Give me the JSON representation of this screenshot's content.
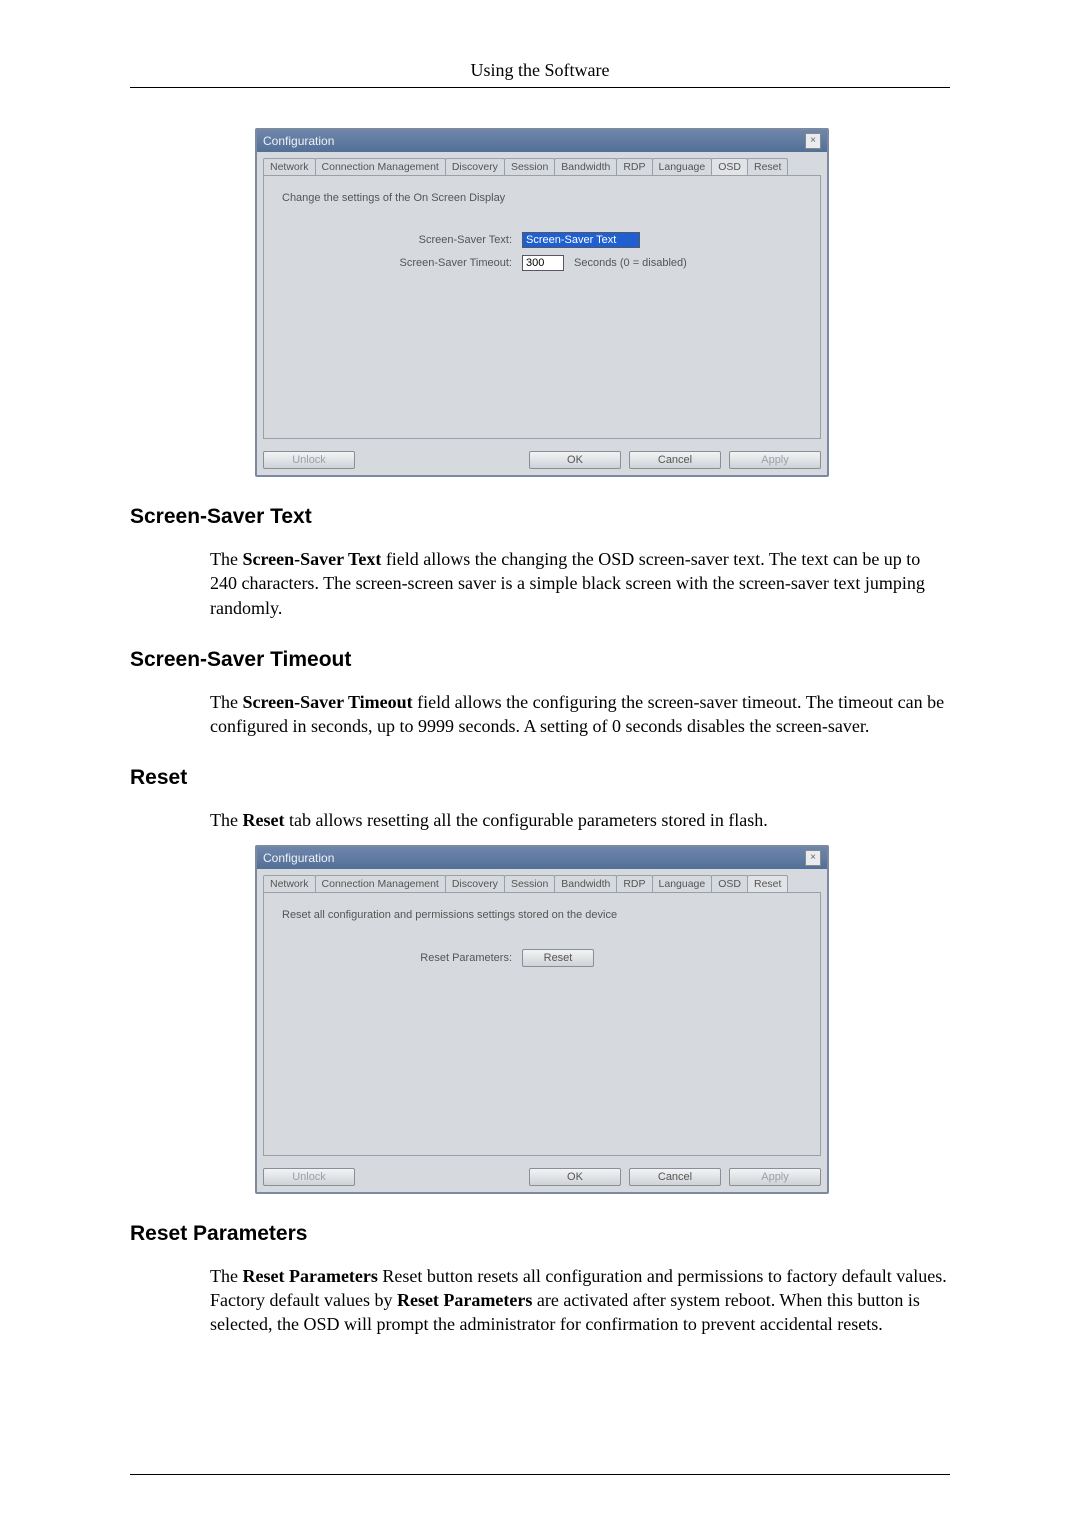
{
  "running_head": "Using the Software",
  "dialog_osd": {
    "title": "Configuration",
    "tabs": [
      "Network",
      "Connection Management",
      "Discovery",
      "Session",
      "Bandwidth",
      "RDP",
      "Language",
      "OSD",
      "Reset"
    ],
    "active_tab_index": 7,
    "description": "Change the settings of the On Screen Display",
    "field_text_label": "Screen-Saver Text:",
    "field_text_value": "Screen-Saver Text",
    "field_timeout_label": "Screen-Saver Timeout:",
    "field_timeout_value": "300",
    "field_timeout_suffix": "Seconds (0 = disabled)",
    "btn_unlock": "Unlock",
    "btn_ok": "OK",
    "btn_cancel": "Cancel",
    "btn_apply": "Apply"
  },
  "dialog_reset": {
    "title": "Configuration",
    "tabs": [
      "Network",
      "Connection Management",
      "Discovery",
      "Session",
      "Bandwidth",
      "RDP",
      "Language",
      "OSD",
      "Reset"
    ],
    "active_tab_index": 8,
    "description": "Reset all configuration and permissions settings stored on the device",
    "field_reset_label": "Reset Parameters:",
    "btn_reset": "Reset",
    "btn_unlock": "Unlock",
    "btn_ok": "OK",
    "btn_cancel": "Cancel",
    "btn_apply": "Apply"
  },
  "sec1_heading": "Screen-Saver Text",
  "sec1_body_pre": "The ",
  "sec1_body_b": "Screen-Saver Text",
  "sec1_body_post": " field allows the changing the OSD screen-saver text. The text can be up to 240 characters. The screen-screen saver is a simple black screen with the screen-saver text jumping randomly.",
  "sec2_heading": "Screen-Saver Timeout",
  "sec2_body_pre": "The ",
  "sec2_body_b": "Screen-Saver Timeout",
  "sec2_body_post": " field allows the configuring the screen-saver timeout. The timeout can be configured in seconds, up to 9999 seconds. A setting of 0 seconds disables the screen-saver.",
  "sec3_heading": "Reset",
  "sec3_body_pre": "The ",
  "sec3_body_b": "Reset",
  "sec3_body_post": " tab allows resetting all the configurable parameters stored in flash.",
  "sec4_heading": "Reset Parameters",
  "sec4_body_pre": "The ",
  "sec4_body_b1": "Reset Parameters",
  "sec4_body_mid": " Reset button resets all configuration and permissions to factory default values. Factory default values by ",
  "sec4_body_b2": "Reset Parameters",
  "sec4_body_post": " are activated after system reboot. When this button is selected, the OSD will prompt the administrator for confirmation to prevent accidental resets."
}
